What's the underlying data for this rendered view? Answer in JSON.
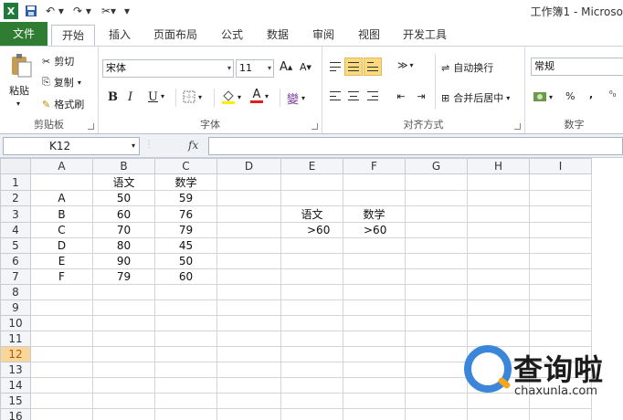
{
  "title_bar": {
    "title": "工作簿1 - Microso",
    "quick_access": [
      "excel-logo-icon",
      "save-icon",
      "undo-icon",
      "redo-icon",
      "customize-icon"
    ]
  },
  "tabs": [
    {
      "label": "文件"
    },
    {
      "label": "开始"
    },
    {
      "label": "插入"
    },
    {
      "label": "页面布局"
    },
    {
      "label": "公式"
    },
    {
      "label": "数据"
    },
    {
      "label": "审阅"
    },
    {
      "label": "视图"
    },
    {
      "label": "开发工具"
    }
  ],
  "ribbon": {
    "clipboard": {
      "label": "剪贴板",
      "paste": "粘贴",
      "cut": "剪切",
      "copy": "复制",
      "format_painter": "格式刷"
    },
    "font": {
      "label": "字体",
      "font_name": "宋体",
      "font_size": "11",
      "bold": "B",
      "italic": "I",
      "underline": "U",
      "font_color_letter": "A"
    },
    "alignment": {
      "label": "对齐方式",
      "wrap_text": "自动换行",
      "merge_center": "合并后居中"
    },
    "number": {
      "label": "数字",
      "format": "常规",
      "percent": "%",
      "comma": ","
    }
  },
  "formula_bar": {
    "name_box": "K12",
    "fx_label": "fx",
    "formula": ""
  },
  "sheet": {
    "columns": [
      "A",
      "B",
      "C",
      "D",
      "E",
      "F",
      "G",
      "H",
      "I"
    ],
    "active_row": 12,
    "rows": [
      {
        "n": "1",
        "cells": [
          "",
          "语文",
          "数学",
          "",
          "",
          "",
          "",
          "",
          ""
        ]
      },
      {
        "n": "2",
        "cells": [
          "A",
          "50",
          "59",
          "",
          "",
          "",
          "",
          "",
          ""
        ]
      },
      {
        "n": "3",
        "cells": [
          "B",
          "60",
          "76",
          "",
          "语文",
          "数学",
          "",
          "",
          ""
        ]
      },
      {
        "n": "4",
        "cells": [
          "C",
          "70",
          "79",
          "",
          ">60",
          ">60",
          "",
          "",
          ""
        ]
      },
      {
        "n": "5",
        "cells": [
          "D",
          "80",
          "45",
          "",
          "",
          "",
          "",
          "",
          ""
        ]
      },
      {
        "n": "6",
        "cells": [
          "E",
          "90",
          "50",
          "",
          "",
          "",
          "",
          "",
          ""
        ]
      },
      {
        "n": "7",
        "cells": [
          "F",
          "79",
          "60",
          "",
          "",
          "",
          "",
          "",
          ""
        ]
      },
      {
        "n": "8",
        "cells": [
          "",
          "",
          "",
          "",
          "",
          "",
          "",
          "",
          ""
        ]
      },
      {
        "n": "9",
        "cells": [
          "",
          "",
          "",
          "",
          "",
          "",
          "",
          "",
          ""
        ]
      },
      {
        "n": "10",
        "cells": [
          "",
          "",
          "",
          "",
          "",
          "",
          "",
          "",
          ""
        ]
      },
      {
        "n": "11",
        "cells": [
          "",
          "",
          "",
          "",
          "",
          "",
          "",
          "",
          ""
        ]
      },
      {
        "n": "12",
        "cells": [
          "",
          "",
          "",
          "",
          "",
          "",
          "",
          "",
          ""
        ]
      },
      {
        "n": "13",
        "cells": [
          "",
          "",
          "",
          "",
          "",
          "",
          "",
          "",
          ""
        ]
      },
      {
        "n": "14",
        "cells": [
          "",
          "",
          "",
          "",
          "",
          "",
          "",
          "",
          ""
        ]
      },
      {
        "n": "15",
        "cells": [
          "",
          "",
          "",
          "",
          "",
          "",
          "",
          "",
          ""
        ]
      },
      {
        "n": "16",
        "cells": [
          "",
          "",
          "",
          "",
          "",
          "",
          "",
          "",
          ""
        ]
      }
    ]
  },
  "watermark": {
    "text": "查询啦",
    "domain": "chaxunla.com"
  },
  "colors": {
    "file_tab": "#2f7d32",
    "active_row_header": "#f9d79a",
    "selected_button": "#fbd97e",
    "watermark_blue": "#3b86d8",
    "watermark_orange": "#f3a51c"
  }
}
